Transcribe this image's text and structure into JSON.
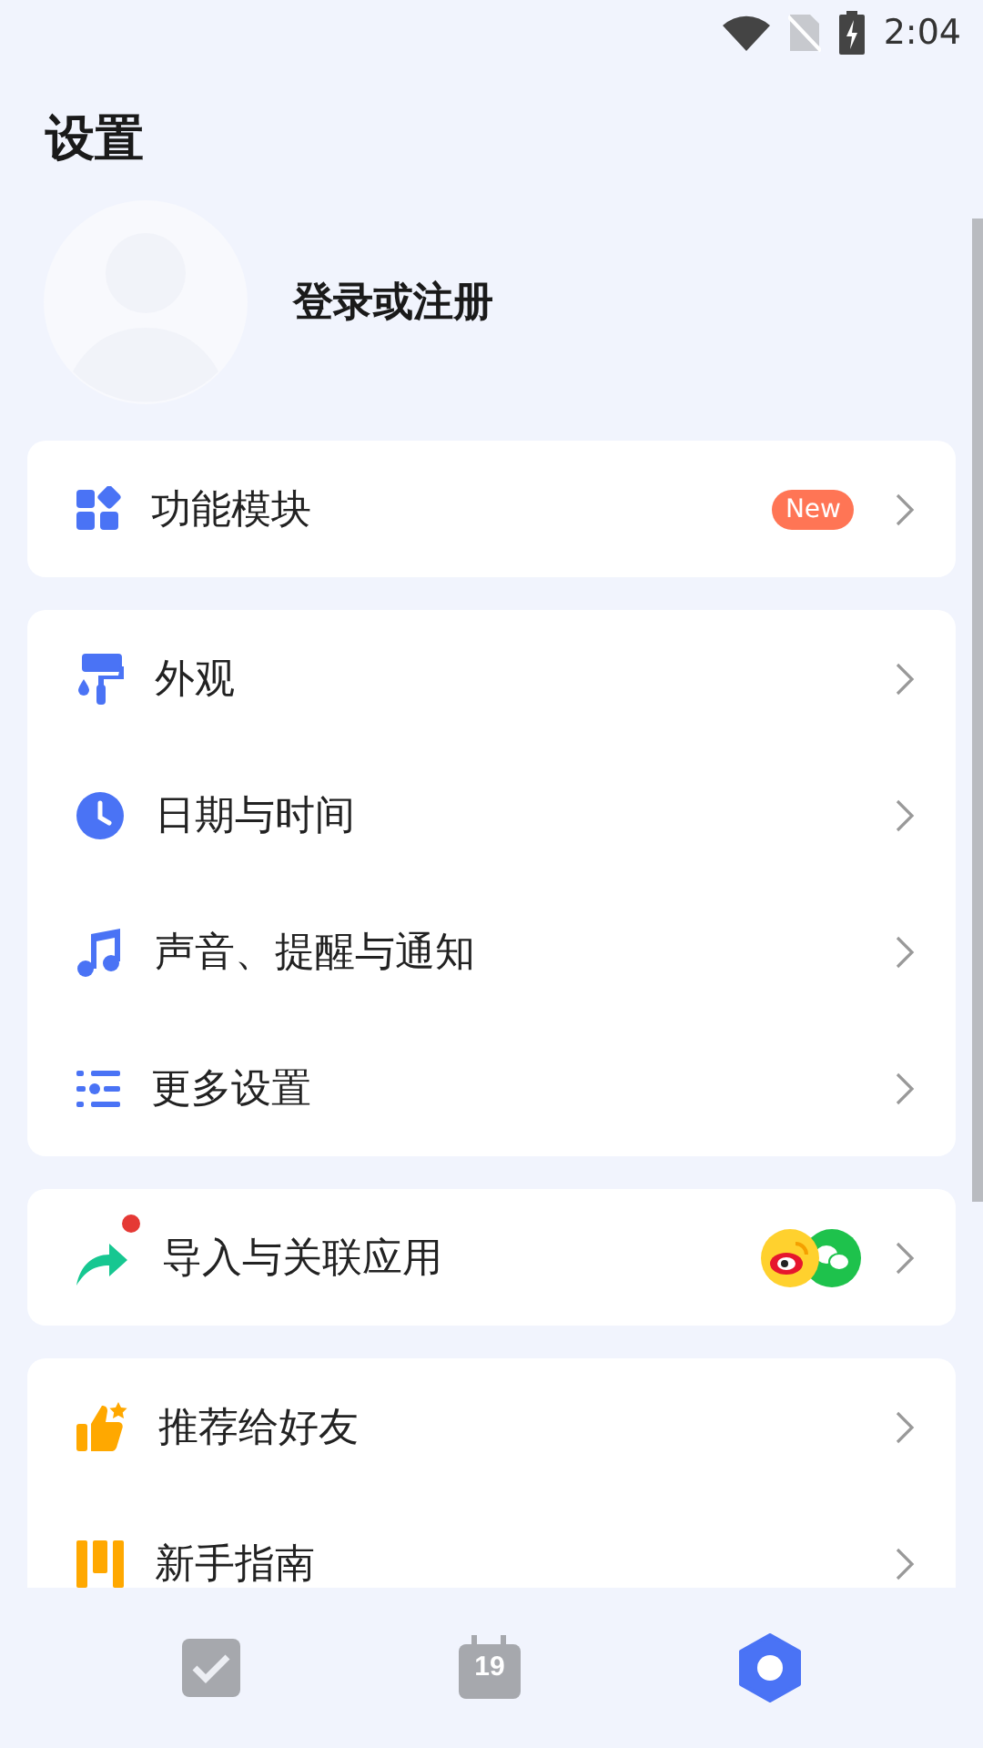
{
  "status_bar": {
    "time": "2:04"
  },
  "title": "设置",
  "account": {
    "label": "登录或注册"
  },
  "groups": [
    {
      "items": [
        {
          "kind": "modules",
          "label": "功能模块",
          "badge": "New"
        }
      ]
    },
    {
      "items": [
        {
          "kind": "appearance",
          "label": "外观"
        },
        {
          "kind": "clock",
          "label": "日期与时间"
        },
        {
          "kind": "music",
          "label": "声音、提醒与通知"
        },
        {
          "kind": "list",
          "label": "更多设置"
        }
      ]
    },
    {
      "items": [
        {
          "kind": "share",
          "label": "导入与关联应用",
          "dot": true,
          "apps": true
        }
      ]
    },
    {
      "items": [
        {
          "kind": "thumb",
          "label": "推荐给好友"
        },
        {
          "kind": "guide",
          "label": "新手指南"
        }
      ]
    }
  ],
  "nav": [
    {
      "kind": "tasks",
      "selected": false
    },
    {
      "kind": "calendar",
      "label": "19",
      "selected": false
    },
    {
      "kind": "settings",
      "selected": true
    }
  ]
}
